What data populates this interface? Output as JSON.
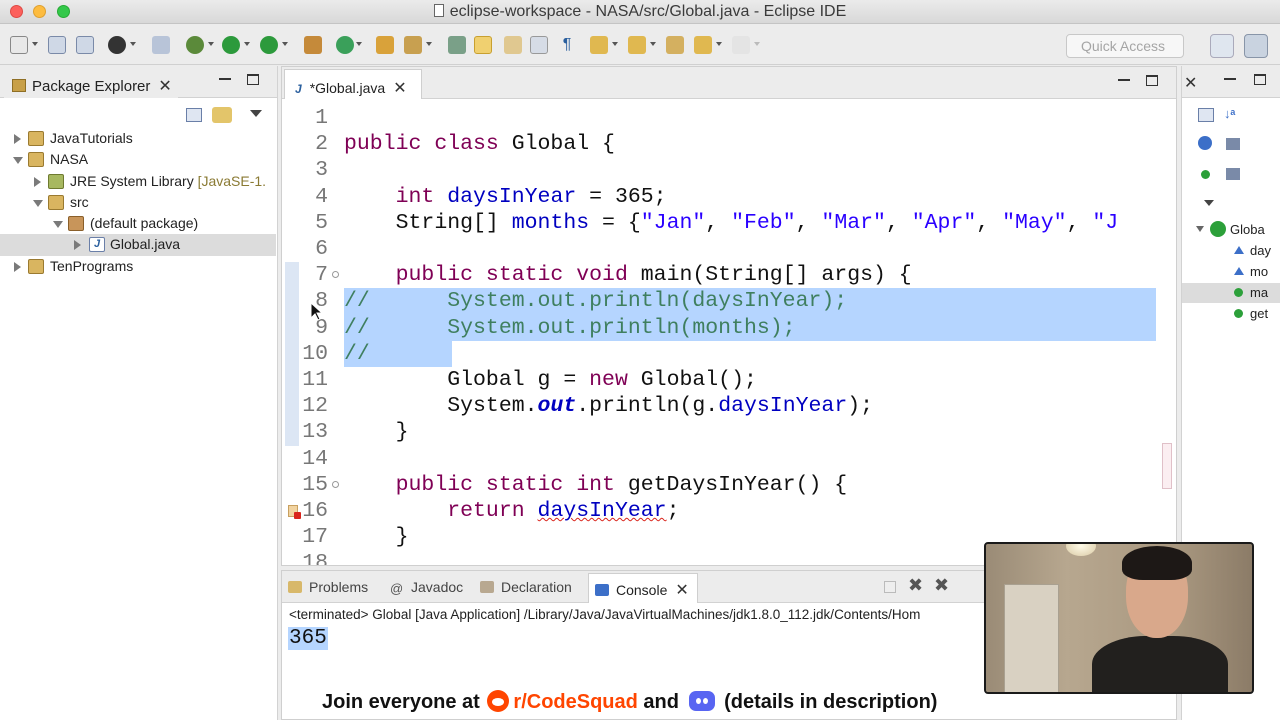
{
  "window": {
    "title": "eclipse-workspace - NASA/src/Global.java - Eclipse IDE"
  },
  "toolbar": {
    "quick_access_placeholder": "Quick Access"
  },
  "package_explorer": {
    "tab_label": "Package Explorer",
    "items": [
      {
        "label": "JavaTutorials",
        "extra": "",
        "depth": 0,
        "expanded": false,
        "icon": "project-icon"
      },
      {
        "label": "NASA",
        "extra": "",
        "depth": 0,
        "expanded": true,
        "icon": "project-icon"
      },
      {
        "label": "JRE System Library ",
        "extra": "[JavaSE-1.",
        "depth": 1,
        "expanded": false,
        "icon": "library-icon"
      },
      {
        "label": "src",
        "extra": "",
        "depth": 1,
        "expanded": true,
        "icon": "source-folder-icon"
      },
      {
        "label": "(default package)",
        "extra": "",
        "depth": 2,
        "expanded": true,
        "icon": "package-icon"
      },
      {
        "label": "Global.java",
        "extra": "",
        "depth": 3,
        "expanded": false,
        "icon": "java-file-icon",
        "selected": true
      },
      {
        "label": "TenPrograms",
        "extra": "",
        "depth": 0,
        "expanded": false,
        "icon": "project-icon"
      }
    ]
  },
  "editor": {
    "tab_label": "*Global.java",
    "lines": [
      {
        "n": "1",
        "html": ""
      },
      {
        "n": "2",
        "html": "<span class='kw'>public class</span> Global {"
      },
      {
        "n": "3",
        "html": ""
      },
      {
        "n": "4",
        "html": "    <span class='kw'>int</span> <span class='fld'>daysInYear</span> = 365;"
      },
      {
        "n": "5",
        "html": "    String[] <span class='fld'>months</span> = {<span class='str'>\"Jan\"</span>, <span class='str'>\"Feb\"</span>, <span class='str'>\"Mar\"</span>, <span class='str'>\"Apr\"</span>, <span class='str'>\"May\"</span>, <span class='str'>\"J</span>"
      },
      {
        "n": "6",
        "html": ""
      },
      {
        "n": "7",
        "html": "    <span class='kw'>public static void</span> main(String[] args) {"
      },
      {
        "n": "8",
        "html": "<span class='cmt'>//      System.out.println(daysInYear);</span>"
      },
      {
        "n": "9",
        "html": "<span class='cmt'>//      System.out.println(months);</span>"
      },
      {
        "n": "10",
        "html": "<span class='cmt'>//</span>"
      },
      {
        "n": "11",
        "html": "        Global g = <span class='kw'>new</span> Global();"
      },
      {
        "n": "12",
        "html": "        System.<span class='sfld'>out</span>.println(g.<span class='fld'>daysInYear</span>);"
      },
      {
        "n": "13",
        "html": "    }"
      },
      {
        "n": "14",
        "html": ""
      },
      {
        "n": "15",
        "html": "    <span class='kw'>public static int</span> getDaysInYear() {"
      },
      {
        "n": "16",
        "html": "        <span class='kw'>return</span> <span class='fld squiggle'>daysInYear</span>;"
      },
      {
        "n": "17",
        "html": "    }"
      },
      {
        "n": "18",
        "html": ""
      }
    ]
  },
  "outline": {
    "items": [
      {
        "label": "Globa",
        "kind": "class"
      },
      {
        "label": "day",
        "kind": "field"
      },
      {
        "label": "mo",
        "kind": "field"
      },
      {
        "label": "ma",
        "kind": "method",
        "selected": true
      },
      {
        "label": "get",
        "kind": "method"
      }
    ]
  },
  "console": {
    "tabs": [
      {
        "label": "Problems",
        "active": false,
        "icon": "problems-icon"
      },
      {
        "label": "Javadoc",
        "active": false,
        "icon": "javadoc-icon"
      },
      {
        "label": "Declaration",
        "active": false,
        "icon": "declaration-icon"
      },
      {
        "label": "Console",
        "active": true,
        "icon": "console-icon"
      }
    ],
    "status": "<terminated> Global [Java Application] /Library/Java/JavaVirtualMachines/jdk1.8.0_112.jdk/Contents/Hom",
    "output": "365"
  },
  "banner": {
    "prefix": "Join everyone at ",
    "subreddit": "r/CodeSquad",
    "middle": " and ",
    "suffix": " (details in description)"
  },
  "colors": {
    "selection": "#b5d5ff",
    "keyword": "#7f0055",
    "field": "#0000c0",
    "string": "#2a00ff",
    "comment": "#3f7f5f",
    "reddit": "#ff4500",
    "discord": "#5865f2"
  }
}
